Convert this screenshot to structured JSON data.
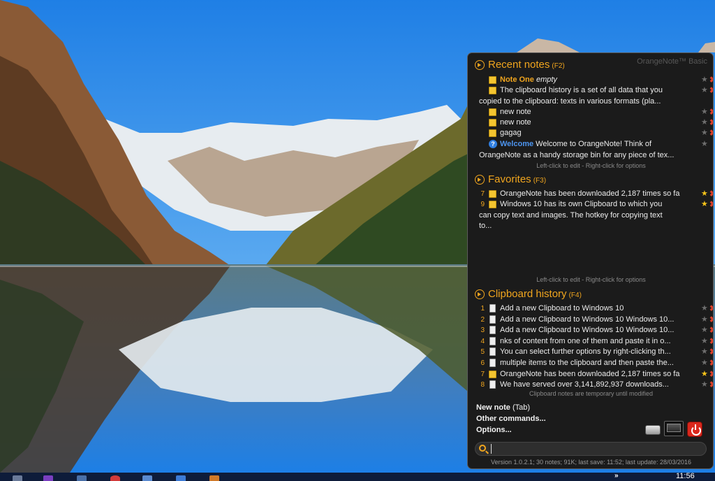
{
  "panel": {
    "brand": "OrangeNote™ Basic",
    "recent": {
      "title": "Recent notes",
      "hotkey": "(F2)",
      "items": [
        {
          "title": "Note One",
          "text": "empty"
        },
        {
          "text": "The clipboard history is a set of all data that you copied to the clipboard: texts in various formats (pla..."
        },
        {
          "text": "new note"
        },
        {
          "text": "new note"
        },
        {
          "text": "gagag"
        },
        {
          "title": "Welcome",
          "text": "Welcome to OrangeNote!  Think of OrangeNote as a handy storage bin for any piece of tex..."
        }
      ],
      "hint": "Left-click to edit - Right-click for options"
    },
    "favorites": {
      "title": "Favorites",
      "hotkey": "(F3)",
      "items": [
        {
          "num": "7",
          "text": "OrangeNote has been downloaded 2,187 times so fa"
        },
        {
          "num": "9",
          "text": "Windows 10 has its own Clipboard to which you can copy text and images. The hotkey for copying text to..."
        }
      ],
      "hint": "Left-click to edit - Right-click for options"
    },
    "clipboard": {
      "title": "Clipboard history",
      "hotkey": "(F4)",
      "items": [
        {
          "num": "1",
          "text": "Add a new Clipboard to Windows 10"
        },
        {
          "num": "2",
          "text": "Add a new Clipboard to Windows 10 Windows 10..."
        },
        {
          "num": "3",
          "text": "Add a new Clipboard to Windows 10 Windows 10..."
        },
        {
          "num": "4",
          "text": "nks of content from one of them and paste it in o..."
        },
        {
          "num": "5",
          "text": "You can select further options by right-clicking th..."
        },
        {
          "num": "6",
          "text": "multiple items to the clipboard and then paste the..."
        },
        {
          "num": "7",
          "text": "OrangeNote has been downloaded 2,187 times so fa"
        },
        {
          "num": "8",
          "text": "We have served over 3,141,892,937 downloads..."
        }
      ],
      "hint": "Clipboard notes are temporary until modified"
    },
    "commands": {
      "new_note": "New note",
      "new_note_key": "(Tab)",
      "other": "Other commands...",
      "options": "Options..."
    },
    "search": {
      "value": ""
    },
    "status": "Version 1.0.2.1; 30 notes; 91K; last save: 11:52; last update: 28/03/2016"
  },
  "taskbar": {
    "chevron": "»",
    "clock": "11:56"
  },
  "colors": {
    "accent": "#f0a51e",
    "panel_bg": "#1b1b1b",
    "delete": "#e0402a",
    "star_active": "#f3c21a"
  }
}
